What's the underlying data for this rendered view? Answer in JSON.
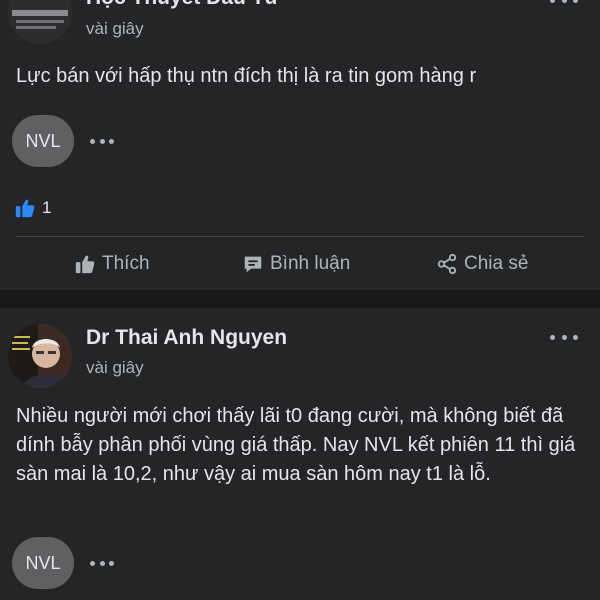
{
  "posts": [
    {
      "author": "Học Thuyết Đầu Tư",
      "time": "vài giây",
      "content": "Lực bán với hấp thụ ntn đích thị là ra tin gom hàng r",
      "tag": "NVL",
      "reaction_count": "1",
      "actions": {
        "like": "Thích",
        "comment": "Bình luận",
        "share": "Chia sẻ"
      }
    },
    {
      "author": "Dr Thai Anh Nguyen",
      "time": "vài giây",
      "content": "Nhiều người mới chơi thấy lãi t0 đang cười, mà không biết đã dính bẫy phân phối vùng giá thấp. Nay NVL kết phiên 11 thì giá sàn mai là 10,2, như vậy ai mua sàn hôm nay t1 là lỗ.",
      "tag": "NVL"
    }
  ],
  "colors": {
    "background": "#242526",
    "divider": "#18191a",
    "like_blue": "#2d88ff",
    "text_primary": "#e4e6eb",
    "text_secondary": "#b0b3b8"
  },
  "icons": {
    "more": "more-horizontal-icon",
    "like_badge": "thumbs-up-badge-icon",
    "like": "thumbs-up-icon",
    "comment": "comment-bubble-icon",
    "share": "share-icon"
  }
}
